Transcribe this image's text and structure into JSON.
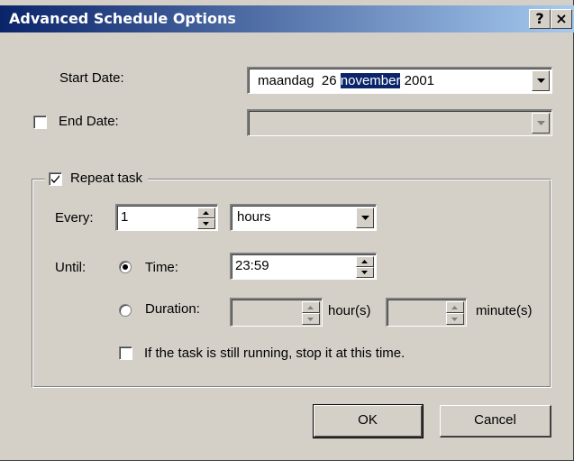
{
  "window": {
    "title": "Advanced Schedule Options",
    "help_label": "?",
    "close_label": "×"
  },
  "start_date": {
    "label": "Start Date:",
    "day_name": "maandag",
    "day": "26",
    "month": "november",
    "year": "2001"
  },
  "end_date": {
    "label": "End Date:",
    "checked": false,
    "value": ""
  },
  "repeat": {
    "label": "Repeat task",
    "checked": true,
    "every_label": "Every:",
    "every_value": "1",
    "unit_value": "hours",
    "until_label": "Until:",
    "time_label": "Time:",
    "time_value": "23:59",
    "time_selected": true,
    "duration_label": "Duration:",
    "hours_value": "",
    "hours_unit": "hour(s)",
    "minutes_value": "",
    "minutes_unit": "minute(s)",
    "stop_label": "If the task is still running, stop it at this time.",
    "stop_checked": false
  },
  "buttons": {
    "ok": "OK",
    "cancel": "Cancel"
  }
}
